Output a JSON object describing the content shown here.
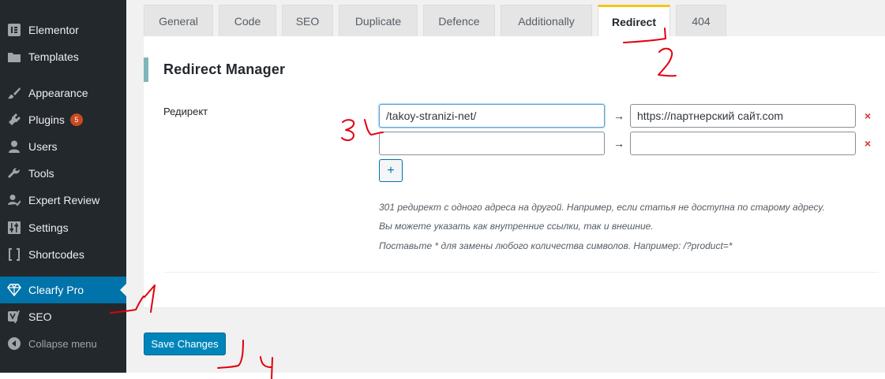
{
  "sidebar": {
    "items": [
      {
        "label": "Elementor",
        "icon": "elementor-icon"
      },
      {
        "label": "Templates",
        "icon": "folder-icon"
      },
      {
        "label": "Appearance",
        "icon": "paintbrush-icon"
      },
      {
        "label": "Plugins",
        "icon": "plug-icon",
        "badge": "5"
      },
      {
        "label": "Users",
        "icon": "user-icon"
      },
      {
        "label": "Tools",
        "icon": "wrench-icon"
      },
      {
        "label": "Expert Review",
        "icon": "reviewer-icon"
      },
      {
        "label": "Settings",
        "icon": "settings-sliders-icon"
      },
      {
        "label": "Shortcodes",
        "icon": "brackets-icon"
      },
      {
        "label": "Clearfy Pro",
        "icon": "diamond-icon",
        "active": true
      },
      {
        "label": "SEO",
        "icon": "yoast-icon"
      },
      {
        "label": "Collapse menu",
        "icon": "collapse-icon"
      }
    ]
  },
  "tabs": [
    "General",
    "Code",
    "SEO",
    "Duplicate",
    "Defence",
    "Additionally",
    "Redirect",
    "404"
  ],
  "active_tab": "Redirect",
  "panel": {
    "title": "Redirect Manager",
    "field_label": "Редирект",
    "rows": [
      {
        "from": "/takoy-stranizi-net/",
        "to": "https://партнерский сайт.com"
      },
      {
        "from": "",
        "to": ""
      }
    ],
    "arrow": "→",
    "remove": "×",
    "add_label": "+",
    "hints": [
      "301 редирект с одного адреса на другой. Например, если статья не доступна по старому адресу.",
      "Вы можете указать как внутренние ссылки, так и внешние.",
      "Поставьте * для замены любого количества символов. Например: /?product=*"
    ]
  },
  "save_label": "Save Changes",
  "colors": {
    "sidebar_bg": "#23282d",
    "active_menu": "#0073aa",
    "tab_active_border": "#f5c518",
    "primary_button": "#0085ba",
    "badge": "#ca4a1f",
    "remove": "#dc3232",
    "annotation": "#e0000f"
  }
}
